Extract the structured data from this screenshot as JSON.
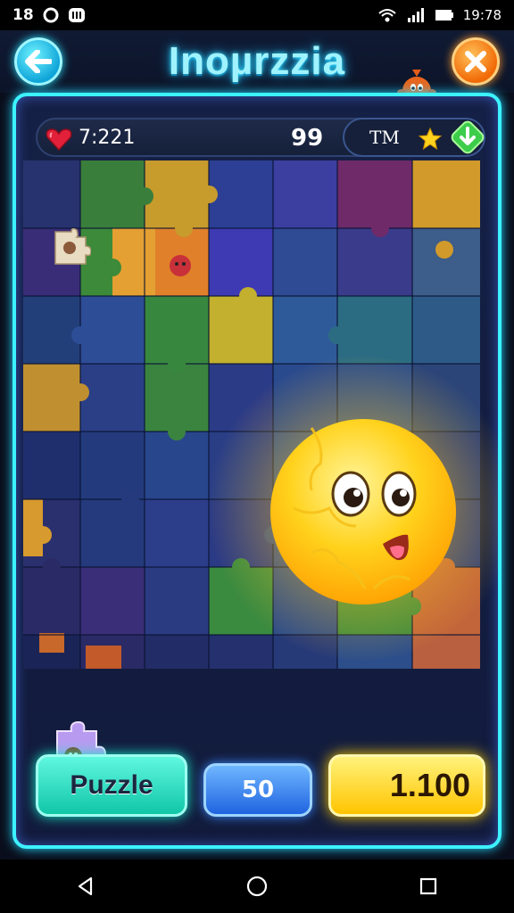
{
  "status_bar": {
    "left_time": "18",
    "left_icons": [
      "notification-o-icon",
      "notification-app-icon"
    ],
    "right_time": "19:78",
    "right_icons": [
      "wifi-icon",
      "signal-icon",
      "battery-icon"
    ]
  },
  "header": {
    "title": "Inoµrzzia",
    "back_icon": "arrow-left-icon",
    "close_icon": "close-x-icon",
    "mascot_icon": "orange-mascot-icon"
  },
  "info_bar": {
    "timer": "7:221",
    "moves": "99",
    "label": "TM",
    "heart_icon": "heart-icon",
    "star_icon": "star-icon",
    "action_icon": "green-down-arrow-icon"
  },
  "buttons": {
    "puzzle_label": "Puzzle",
    "score_label": "50",
    "coins_label": "1.100"
  },
  "colors": {
    "accent_cyan": "#3cf2ff",
    "accent_purple": "#b34dff",
    "puzzle_green": "#11c6a8",
    "score_blue": "#1f64e0",
    "coins_yellow": "#ffc400"
  },
  "navbar": {
    "icons": [
      "nav-back-icon",
      "nav-home-icon",
      "nav-recents-icon"
    ]
  }
}
